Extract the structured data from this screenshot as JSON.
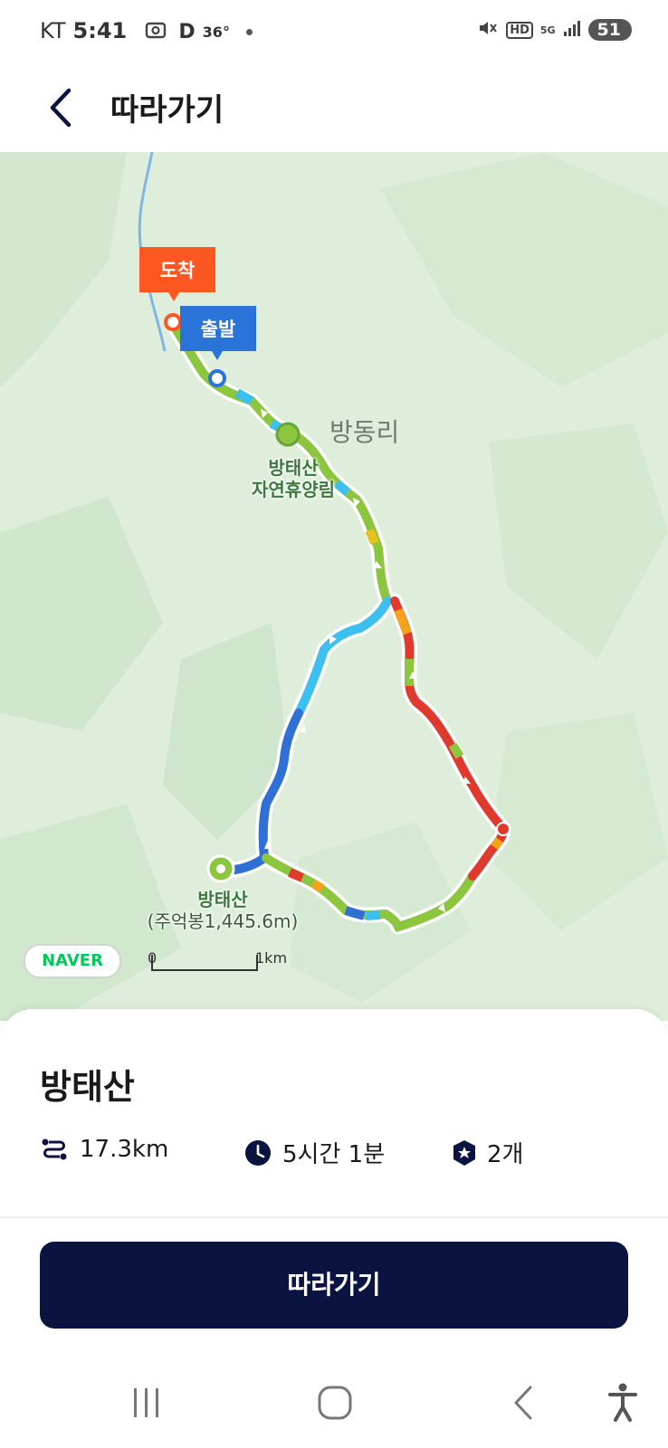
{
  "status_bar": {
    "carrier": "KT",
    "time": "5:41",
    "indicator_d": "D",
    "temperature": "36°",
    "hd": "HD",
    "network": "5G",
    "battery": "51"
  },
  "header": {
    "title": "따라가기",
    "back_icon": "chevron-left-icon"
  },
  "map": {
    "village_label": "방동리",
    "forest_name_line1": "방태산",
    "forest_name_line2": "자연휴양림",
    "peak_name": "방태산",
    "peak_detail": "(주억봉1,445.6m)",
    "arrival_label": "도착",
    "start_label": "출발",
    "naver_logo": "NAVER",
    "scale_zero": "0",
    "scale_km": "1km",
    "colors": {
      "green": "#8cc63f",
      "blue": "#2f6fd6",
      "cyan": "#3cc0f0",
      "red": "#e03a2f",
      "orange": "#ff5722",
      "start_pin": "#2a73d9"
    }
  },
  "course": {
    "name": "방태산",
    "distance": "17.3km",
    "duration": "5시간 1분",
    "count": "2개",
    "distance_icon": "route-icon",
    "duration_icon": "clock-icon",
    "count_icon": "star-badge-icon"
  },
  "action": {
    "follow_label": "따라가기"
  },
  "navbar": {
    "recent_icon": "recent-apps-icon",
    "home_icon": "home-icon",
    "back_icon": "back-icon",
    "accessibility_icon": "accessibility-icon"
  }
}
